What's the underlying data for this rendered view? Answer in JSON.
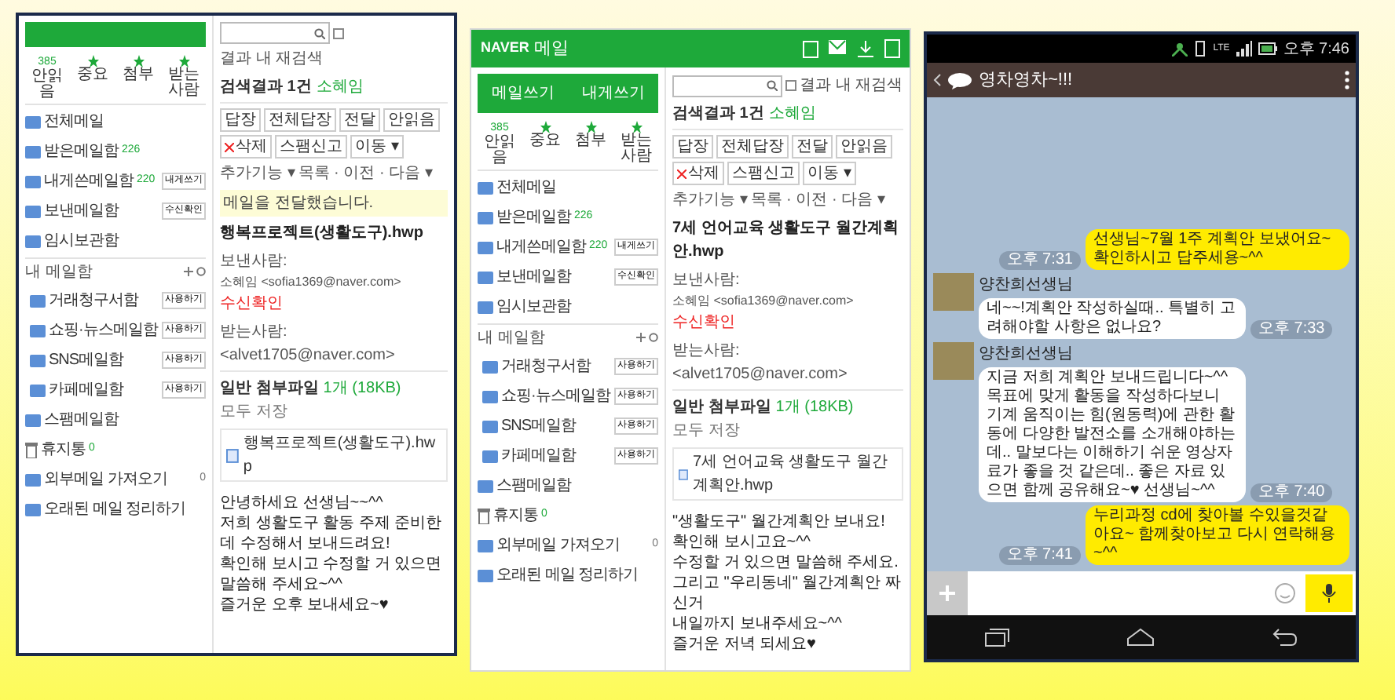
{
  "mail_windows": [
    {
      "quick_filters": [
        {
          "label": "안읽음",
          "count": "385"
        },
        {
          "label": "중요"
        },
        {
          "label": "첨부"
        },
        {
          "label": "받는사람"
        }
      ],
      "folders": [
        {
          "kind": "folder",
          "label": "전체메일"
        },
        {
          "kind": "folder",
          "label": "받은메일함",
          "count": "226"
        },
        {
          "kind": "folder",
          "label": "내게쓴메일함",
          "count": "220",
          "action": "내게쓰기"
        },
        {
          "kind": "folder",
          "label": "보낸메일함",
          "action": "수신확인"
        },
        {
          "kind": "folder",
          "label": "임시보관함"
        },
        {
          "kind": "section",
          "label": "내 메일함"
        },
        {
          "kind": "sub",
          "label": "거래청구서함",
          "action": "사용하기"
        },
        {
          "kind": "sub",
          "label": "쇼핑·뉴스메일함",
          "action": "사용하기"
        },
        {
          "kind": "sub",
          "label": "SNS메일함",
          "action": "사용하기"
        },
        {
          "kind": "sub",
          "label": "카페메일함",
          "action": "사용하기"
        },
        {
          "kind": "folder",
          "label": "스팸메일함"
        },
        {
          "kind": "trash",
          "label": "휴지통",
          "count": "0"
        },
        {
          "kind": "folder",
          "label": "외부메일 가져오기",
          "count": "0"
        },
        {
          "kind": "folder",
          "label": "오래된 메일 정리하기"
        }
      ],
      "search": {
        "in_results": false,
        "label": "결과 내 재검색"
      },
      "results": {
        "label": "검색결과 1건",
        "query": "소혜임"
      },
      "toolbar": [
        {
          "kind": "button",
          "label": "답장"
        },
        {
          "kind": "button",
          "label": "전체답장"
        },
        {
          "kind": "button",
          "label": "전달"
        },
        {
          "kind": "button",
          "label": "안읽음"
        },
        {
          "kind": "delete",
          "label": "삭제"
        },
        {
          "kind": "button",
          "label": "스팸신고"
        },
        {
          "kind": "button",
          "label": "이동 ▾"
        },
        {
          "kind": "link",
          "label": "추가기능 ▾"
        },
        {
          "kind": "link",
          "label": "목록 · 이전 · 다음 ▾"
        }
      ],
      "notice": "메일을 전달했습니다.",
      "subject": "행복프로젝트(생활도구).hwp",
      "sender": {
        "label": "보낸사람:",
        "name": "소혜임 <sofia1369@naver.com>",
        "action": "수신확인"
      },
      "receiver": "받는사람: <alvet1705@naver.com>",
      "attachment": {
        "title": "일반 첨부파일",
        "count": "1개 (18KB)",
        "action": "모두 저장",
        "file": "행복프로젝트(생활도구).hwp"
      },
      "body": [
        "안녕하세요 선생님~~^^",
        "저희 생활도구 활동 주제 준비한데 수정해서 보내드려요!",
        "확인해 보시고 수정할 거 있으면 말씀해 주세요~^^",
        "즐거운 오후 보내세요~♥"
      ]
    },
    {
      "app_bar": {
        "logo": "NAVER",
        "title": "메일"
      },
      "compose_buttons": [
        "메일쓰기",
        "내게쓰기"
      ],
      "quick_filters": [
        {
          "label": "안읽음",
          "count": "385"
        },
        {
          "label": "중요"
        },
        {
          "label": "첨부"
        },
        {
          "label": "받는사람"
        }
      ],
      "folders": [
        {
          "kind": "folder",
          "label": "전체메일"
        },
        {
          "kind": "folder",
          "label": "받은메일함",
          "count": "226"
        },
        {
          "kind": "folder",
          "label": "내게쓴메일함",
          "count": "220",
          "action": "내게쓰기"
        },
        {
          "kind": "folder",
          "label": "보낸메일함",
          "action": "수신확인"
        },
        {
          "kind": "folder",
          "label": "임시보관함"
        },
        {
          "kind": "section",
          "label": "내 메일함"
        },
        {
          "kind": "sub",
          "label": "거래청구서함",
          "action": "사용하기"
        },
        {
          "kind": "sub",
          "label": "쇼핑·뉴스메일함",
          "action": "사용하기"
        },
        {
          "kind": "sub",
          "label": "SNS메일함",
          "action": "사용하기"
        },
        {
          "kind": "sub",
          "label": "카페메일함",
          "action": "사용하기"
        },
        {
          "kind": "folder",
          "label": "스팸메일함"
        },
        {
          "kind": "trash",
          "label": "휴지통",
          "count": "0"
        },
        {
          "kind": "folder",
          "label": "외부메일 가져오기",
          "count": "0"
        },
        {
          "kind": "folder",
          "label": "오래된 메일 정리하기"
        }
      ],
      "search": {
        "in_results": false,
        "label": "결과 내 재검색"
      },
      "results": {
        "label": "검색결과 1건",
        "query": "소혜임"
      },
      "toolbar": [
        {
          "kind": "button",
          "label": "답장"
        },
        {
          "kind": "button",
          "label": "전체답장"
        },
        {
          "kind": "button",
          "label": "전달"
        },
        {
          "kind": "button",
          "label": "안읽음"
        },
        {
          "kind": "delete",
          "label": "삭제"
        },
        {
          "kind": "button",
          "label": "스팸신고"
        },
        {
          "kind": "button",
          "label": "이동 ▾"
        },
        {
          "kind": "link",
          "label": "추가기능 ▾"
        },
        {
          "kind": "link",
          "label": "목록 · 이전 · 다음 ▾"
        }
      ],
      "subject": "7세 언어교육 생활도구 월간계획안.hwp",
      "sender": {
        "label": "보낸사람:",
        "name": "소혜임 <sofia1369@naver.com>",
        "action": "수신확인"
      },
      "receiver": "받는사람: <alvet1705@naver.com>",
      "attachment": {
        "title": "일반 첨부파일",
        "count": "1개 (18KB)",
        "action": "모두 저장",
        "file": "7세 언어교육 생활도구 월간계획안.hwp"
      },
      "body": [
        "\"생활도구\" 월간계획안 보내요!",
        "확인해 보시고요~^^",
        "수정할 거 있으면 말씀해 주세요.",
        "그리고 \"우리동네\" 월간계획안 짜신거",
        "내일까지 보내주세요~^^",
        "즐거운 저녁 되세요♥"
      ]
    }
  ],
  "chat": {
    "status_bar": {
      "network": "LTE",
      "time": "오후 7:46"
    },
    "title": "영차영차~!!!",
    "messages": [
      {
        "mine": true,
        "text": "선생님~7월 1주 계획안 보냈어요~확인하시고 답주세용~^^",
        "time": "오후 7:31"
      },
      {
        "mine": false,
        "sender": "양찬희선생님",
        "text": "네~~!계획안 작성하실때.. 특별히 고려해야할 사항은 없나요?",
        "time": "오후 7:33"
      },
      {
        "mine": false,
        "sender": "양찬희선생님",
        "text": "지금 저희 계획안 보내드립니다~^^ 목표에 맞게 활동을 작성하다보니 기계 움직이는 힘(원동력)에 관한 활동에 다양한 발전소를 소개해야하는데.. 말보다는 이해하기 쉬운 영상자료가 좋을 것 같은데.. 좋은 자료 있으면 함께 공유해요~♥ 선생님~^^",
        "time": "오후 7:40"
      },
      {
        "mine": true,
        "text": "누리과정 cd에 찾아볼 수있을것같아요~ 함께찾아보고 다시 연락해용~^^",
        "time": "오후 7:41"
      }
    ]
  }
}
